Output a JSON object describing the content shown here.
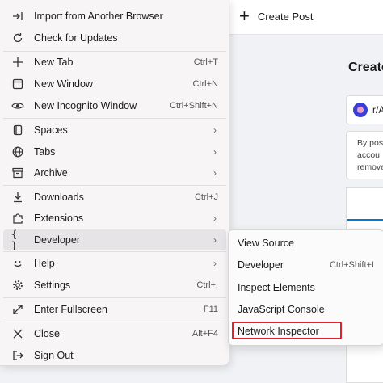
{
  "header": {
    "create_post_label": "Create Post"
  },
  "page": {
    "title": "Create",
    "community_name": "r/A",
    "notice_lines": [
      "By pos",
      "accou",
      "remove"
    ]
  },
  "menu": {
    "items": [
      {
        "label": "Import from Another Browser",
        "shortcut": "",
        "icon": "import-icon"
      },
      {
        "label": "Check for Updates",
        "shortcut": "",
        "icon": "update-icon"
      },
      {
        "label": "New Tab",
        "shortcut": "Ctrl+T",
        "icon": "plus-icon"
      },
      {
        "label": "New Window",
        "shortcut": "Ctrl+N",
        "icon": "window-icon"
      },
      {
        "label": "New Incognito Window",
        "shortcut": "Ctrl+Shift+N",
        "icon": "incognito-icon"
      },
      {
        "label": "Spaces",
        "shortcut": "",
        "icon": "spaces-icon"
      },
      {
        "label": "Tabs",
        "shortcut": "",
        "icon": "globe-icon"
      },
      {
        "label": "Archive",
        "shortcut": "",
        "icon": "archive-icon"
      },
      {
        "label": "Downloads",
        "shortcut": "Ctrl+J",
        "icon": "download-icon"
      },
      {
        "label": "Extensions",
        "shortcut": "",
        "icon": "extensions-icon"
      },
      {
        "label": "Developer",
        "shortcut": "",
        "icon": "braces-icon"
      },
      {
        "label": "Help",
        "shortcut": "",
        "icon": "smile-icon"
      },
      {
        "label": "Settings",
        "shortcut": "Ctrl+,",
        "icon": "gear-icon"
      },
      {
        "label": "Enter Fullscreen",
        "shortcut": "F11",
        "icon": "fullscreen-icon"
      },
      {
        "label": "Close",
        "shortcut": "Alt+F4",
        "icon": "close-icon"
      },
      {
        "label": "Sign Out",
        "shortcut": "",
        "icon": "sign-out-icon"
      }
    ]
  },
  "submenu": {
    "items": [
      {
        "label": "View Source",
        "shortcut": ""
      },
      {
        "label": "Developer",
        "shortcut": "Ctrl+Shift+I"
      },
      {
        "label": "Inspect Elements",
        "shortcut": ""
      },
      {
        "label": "JavaScript Console",
        "shortcut": ""
      },
      {
        "label": "Network Inspector",
        "shortcut": ""
      }
    ]
  },
  "colors": {
    "highlight_box": "#e0202c",
    "accent": "#0079d3"
  }
}
